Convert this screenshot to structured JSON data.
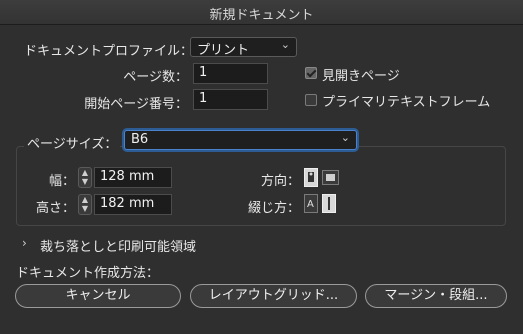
{
  "window": {
    "title": "新規ドキュメント"
  },
  "profile": {
    "label": "ドキュメントプロファイル：",
    "value": "プリント"
  },
  "pages": {
    "label": "ページ数：",
    "value": "1"
  },
  "start_page": {
    "label": "開始ページ番号：",
    "value": "1"
  },
  "facing_pages": {
    "label": "見開きページ",
    "checked": true
  },
  "primary_text_frame": {
    "label": "プライマリテキストフレーム",
    "checked": false
  },
  "page_size": {
    "label": "ページサイズ：",
    "value": "B6"
  },
  "width": {
    "label": "幅：",
    "value": "128 mm"
  },
  "height": {
    "label": "高さ：",
    "value": "182 mm"
  },
  "orientation": {
    "label": "方向："
  },
  "binding": {
    "label": "綴じ方："
  },
  "bleed_slug": {
    "label": "裁ち落としと印刷可能領域"
  },
  "create_method": {
    "label": "ドキュメント作成方法："
  },
  "buttons": {
    "cancel": "キャンセル",
    "layout_grid": "レイアウトグリッド...",
    "margins_columns": "マージン・段組..."
  }
}
